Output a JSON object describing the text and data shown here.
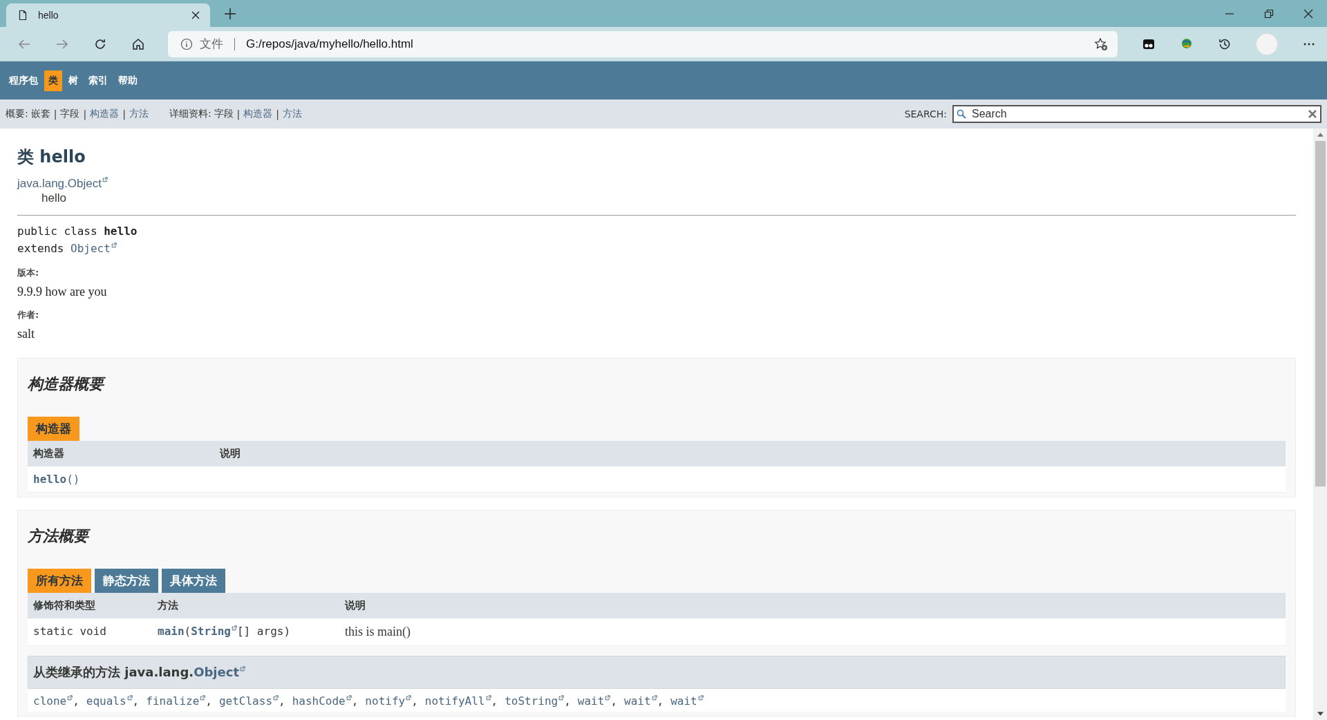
{
  "browser": {
    "tab_title": "hello",
    "address_prefix": "文件",
    "url": "G:/repos/java/myhello/hello.html"
  },
  "nav": {
    "items": [
      {
        "label": "程序包",
        "selected": false
      },
      {
        "label": "类",
        "selected": true
      },
      {
        "label": "树",
        "selected": false
      },
      {
        "label": "索引",
        "selected": false
      },
      {
        "label": "帮助",
        "selected": false
      }
    ]
  },
  "subnav": {
    "summary_label": "概要:",
    "summary_links": [
      {
        "label": "嵌套",
        "enabled": false
      },
      {
        "separator": "|",
        "label": "字段",
        "enabled": false
      },
      {
        "separator": "|",
        "label": "构造器",
        "enabled": true
      },
      {
        "separator": "|",
        "label": "方法",
        "enabled": true
      }
    ],
    "detail_label": "详细资料:",
    "detail_links": [
      {
        "label": "字段",
        "enabled": false
      },
      {
        "separator": "|",
        "label": "构造器",
        "enabled": true
      },
      {
        "separator": "|",
        "label": "方法",
        "enabled": true
      }
    ],
    "search": {
      "label": "SEARCH:",
      "placeholder": "Search"
    }
  },
  "class": {
    "title": "类 hello",
    "superclass": "java.lang.Object",
    "name": "hello",
    "signature_line_1": "public class **hello**",
    "signature_extends": "extends",
    "signature_parent": "Object",
    "tags": [
      {
        "label": "版本:",
        "value": "9.9.9 how are you"
      },
      {
        "label": "作者:",
        "value": "salt"
      }
    ]
  },
  "constructor_summary": {
    "heading": "构造器概要",
    "tabs": [
      {
        "label": "构造器",
        "selected": true
      }
    ],
    "columns": [
      "构造器",
      "说明"
    ],
    "rows": [
      {
        "constructor": "**hello**()"
      }
    ]
  },
  "method_summary": {
    "heading": "方法概要",
    "tabs": [
      {
        "label": "所有方法",
        "selected": true
      },
      {
        "label": "静态方法",
        "selected": false
      },
      {
        "label": "具体方法",
        "selected": false
      }
    ],
    "columns": [
      "修饰符和类型",
      "方法",
      "说明"
    ],
    "rows": [
      {
        "modifier": "static void",
        "method": [
          {
            "text": "main",
            "kind": "member"
          },
          {
            "text": "(",
            "kind": "plain"
          },
          {
            "text": "String",
            "kind": "external"
          },
          {
            "text": "[] args)",
            "kind": "plain"
          }
        ],
        "description": "this is main()"
      }
    ],
    "inherited": {
      "heading": "从类继承的方法 java.lang.",
      "heading_link": "Object",
      "methods": [
        {
          "name": "clone"
        },
        {
          "separator": ",",
          "name": "equals"
        },
        {
          "separator": ",",
          "name": "finalize"
        },
        {
          "separator": ",",
          "name": "getClass"
        },
        {
          "separator": ",",
          "name": "hashCode"
        },
        {
          "separator": ",",
          "name": "notify"
        },
        {
          "separator": ",",
          "name": "notifyAll"
        },
        {
          "separator": ",",
          "name": "toString"
        },
        {
          "separator": ",",
          "name": "wait"
        },
        {
          "separator": ",",
          "name": "wait"
        },
        {
          "separator": ",",
          "name": "wait"
        }
      ]
    }
  }
}
